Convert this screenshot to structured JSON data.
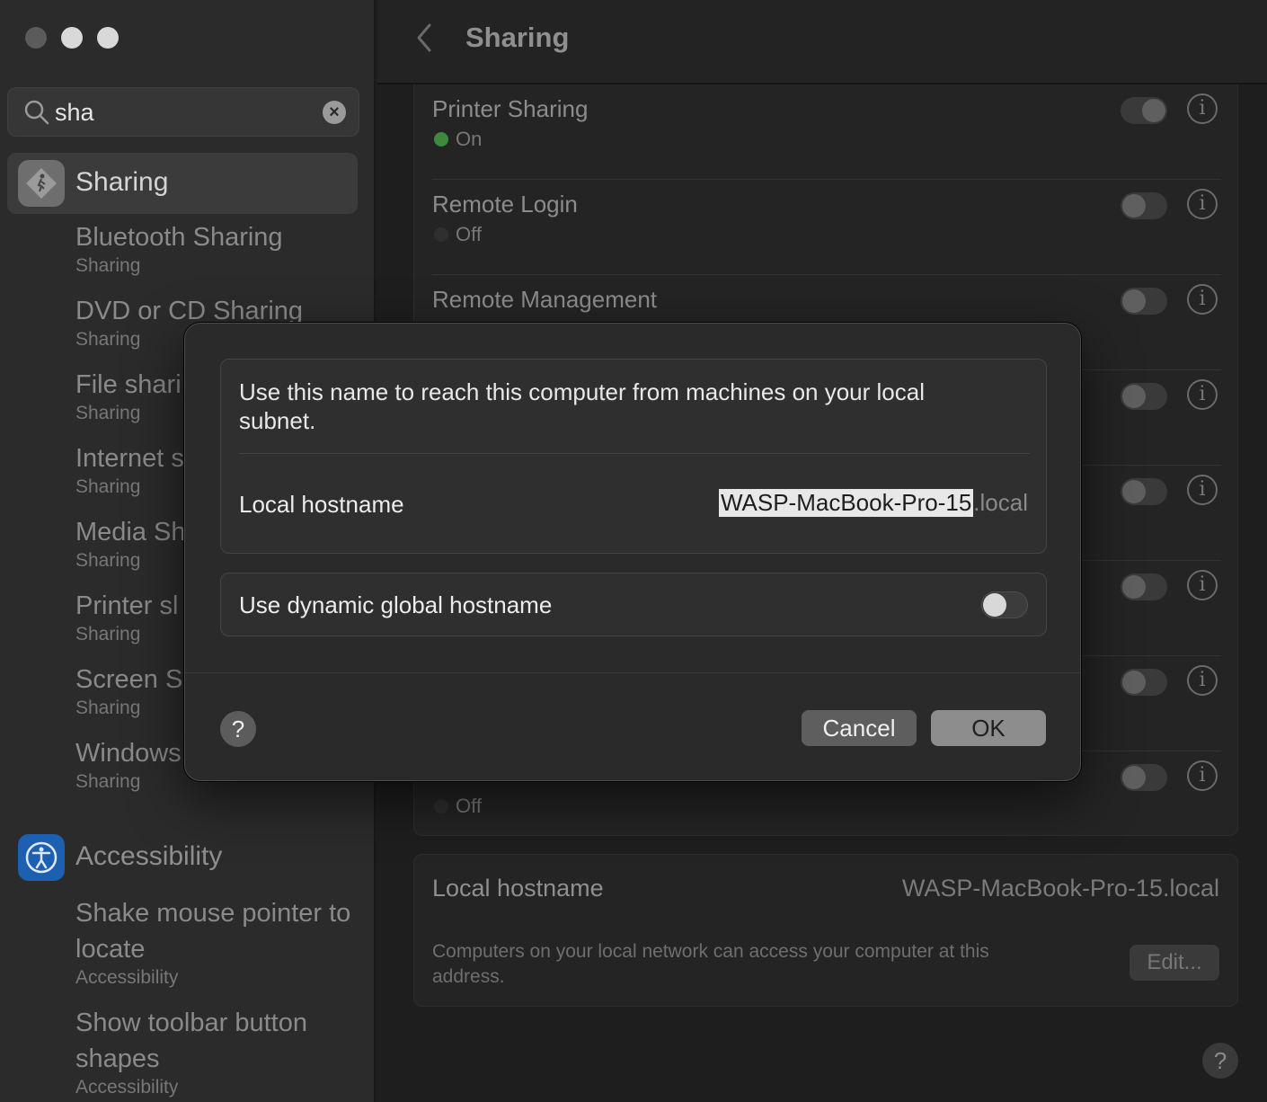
{
  "window": {
    "traffic_lights": [
      "close",
      "minimize",
      "zoom"
    ]
  },
  "sidebar": {
    "search_value": "sha",
    "selected": {
      "label": "Sharing",
      "icon": "sharing-icon"
    },
    "sharing_results": [
      {
        "title": "Bluetooth Sharing",
        "sub": "Sharing"
      },
      {
        "title": "DVD or CD Sharing",
        "sub": "Sharing"
      },
      {
        "title": "File shari",
        "sub": "Sharing"
      },
      {
        "title": "Internet s",
        "sub": "Sharing"
      },
      {
        "title": "Media Sh",
        "sub": "Sharing"
      },
      {
        "title": "Printer sl",
        "sub": "Sharing"
      },
      {
        "title": "Screen S",
        "sub": "Sharing"
      },
      {
        "title": "Windows",
        "sub": "Sharing"
      }
    ],
    "accessibility": {
      "label": "Accessibility",
      "icon": "accessibility-icon",
      "results": [
        {
          "title": "Shake mouse pointer to locate",
          "sub": "Accessibility"
        },
        {
          "title": "Show toolbar button shapes",
          "sub": "Accessibility"
        }
      ]
    }
  },
  "main": {
    "title": "Sharing",
    "services": [
      {
        "name": "Printer Sharing",
        "status": "On",
        "on": true
      },
      {
        "name": "Remote Login",
        "status": "Off",
        "on": false
      },
      {
        "name": "Remote Management",
        "status": "",
        "on": false
      },
      {
        "name": "",
        "status": "",
        "on": false
      },
      {
        "name": "",
        "status": "",
        "on": false
      },
      {
        "name": "",
        "status": "",
        "on": false
      },
      {
        "name": "",
        "status": "",
        "on": false
      },
      {
        "name": "",
        "status": "Off",
        "on": false
      }
    ],
    "hostname_panel": {
      "label": "Local hostname",
      "value": "WASP-MacBook-Pro-15.local",
      "description": "Computers on your local network can access your computer at this address.",
      "edit_label": "Edit..."
    },
    "help_label": "?"
  },
  "dialog": {
    "description": "Use this name to reach this computer from machines on your local subnet.",
    "hostname_label": "Local hostname",
    "hostname_value": "WASP-MacBook-Pro-15",
    "hostname_suffix": ".local",
    "dynamic_label": "Use dynamic global hostname",
    "dynamic_enabled": false,
    "help_label": "?",
    "cancel_label": "Cancel",
    "ok_label": "OK"
  },
  "colors": {
    "status_on": "#3d8a3e",
    "accessibility_icon_bg": "#1d5fb0"
  }
}
